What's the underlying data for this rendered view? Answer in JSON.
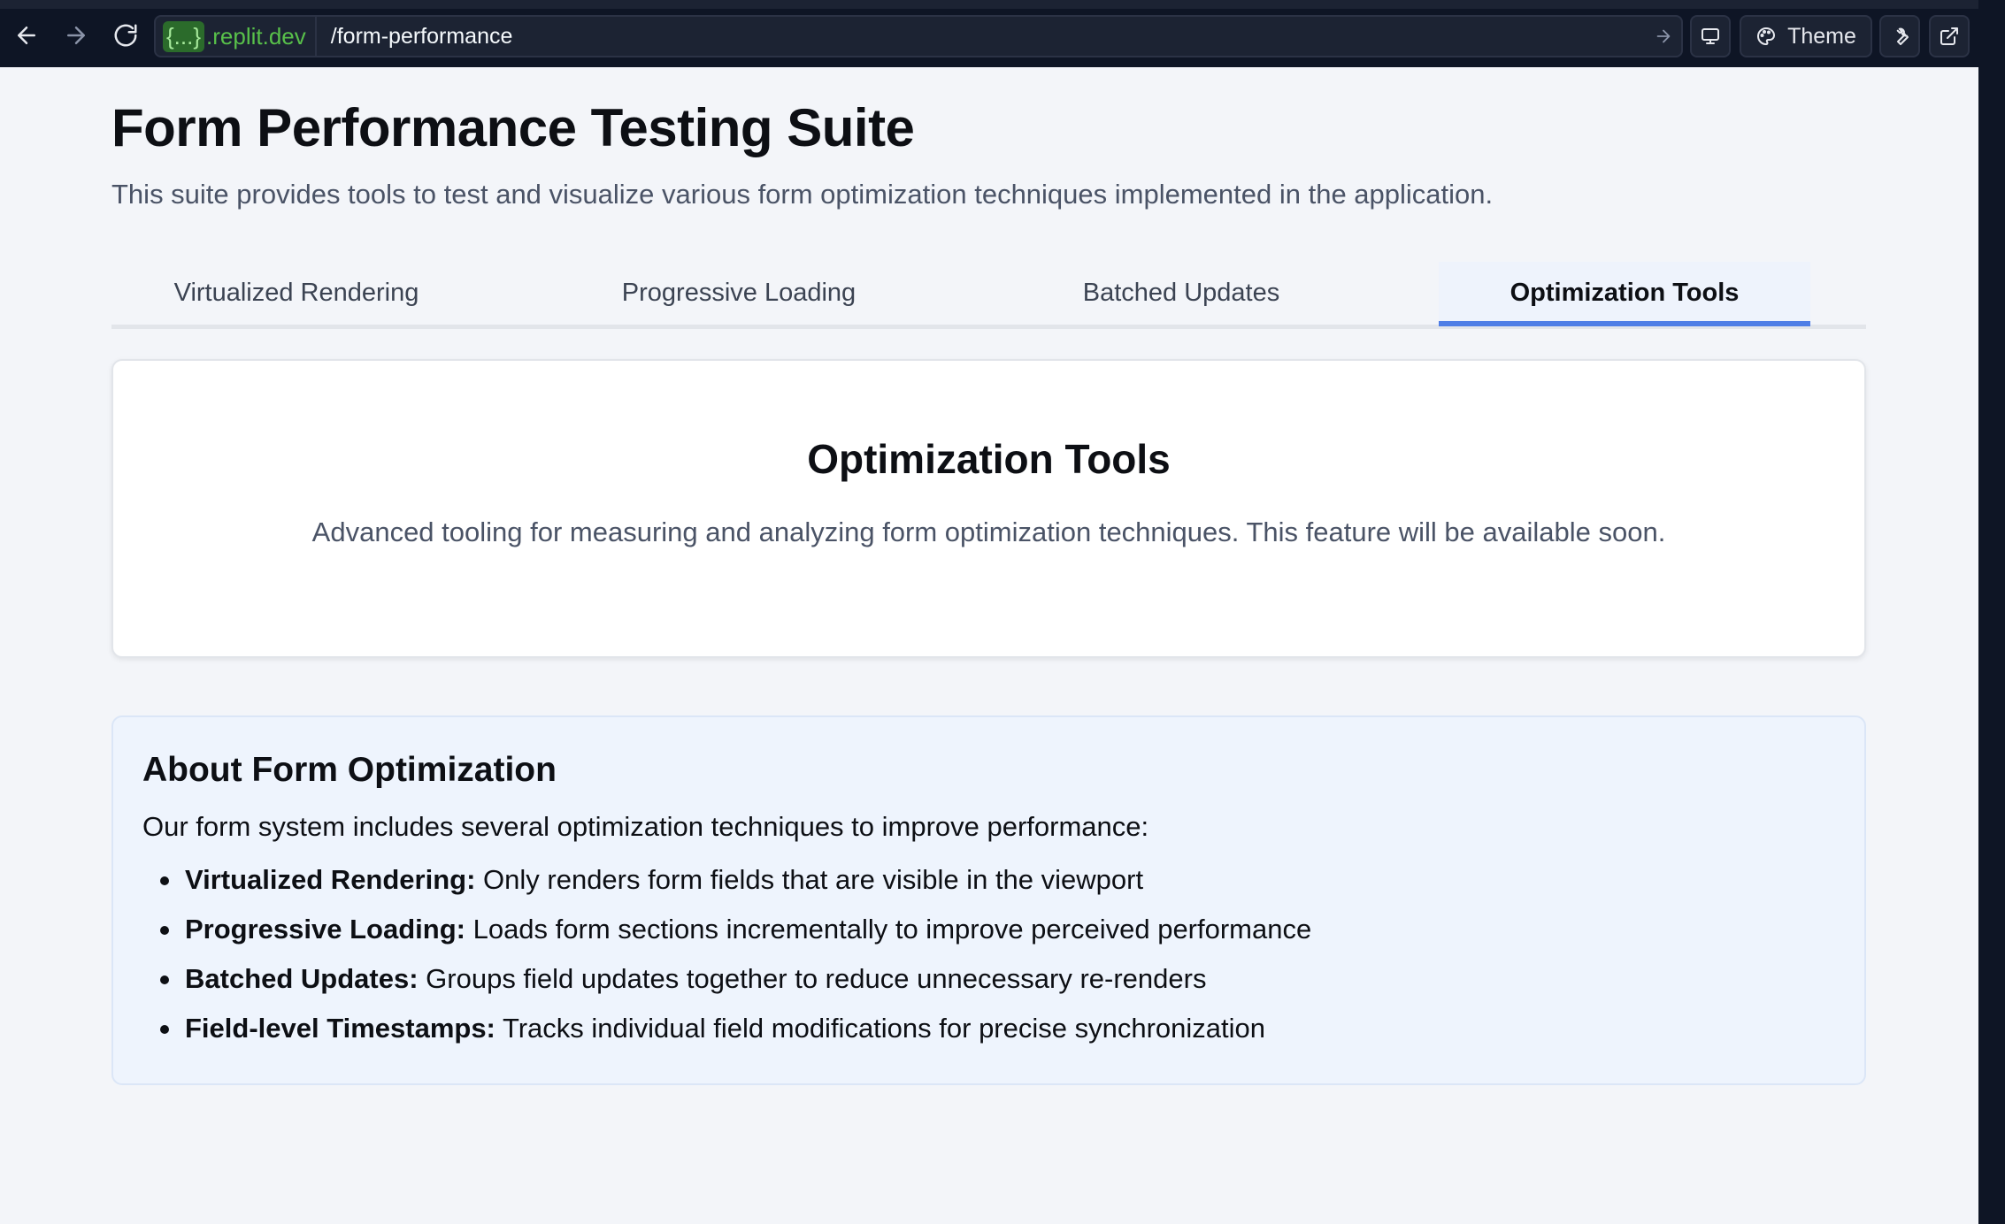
{
  "browser": {
    "url_host_chip": "{...}",
    "url_host": ".replit.dev",
    "url_path": "/form-performance",
    "theme_label": "Theme"
  },
  "page": {
    "title": "Form Performance Testing Suite",
    "subtitle": "This suite provides tools to test and visualize various form optimization techniques implemented in the application."
  },
  "tabs": [
    {
      "label": "Virtualized Rendering",
      "active": false
    },
    {
      "label": "Progressive Loading",
      "active": false
    },
    {
      "label": "Batched Updates",
      "active": false
    },
    {
      "label": "Optimization Tools",
      "active": true
    }
  ],
  "card": {
    "heading": "Optimization Tools",
    "text": "Advanced tooling for measuring and analyzing form optimization techniques. This feature will be available soon."
  },
  "about": {
    "heading": "About Form Optimization",
    "intro": "Our form system includes several optimization techniques to improve performance:",
    "items": [
      {
        "term": "Virtualized Rendering:",
        "desc": " Only renders form fields that are visible in the viewport"
      },
      {
        "term": "Progressive Loading:",
        "desc": " Loads form sections incrementally to improve perceived performance"
      },
      {
        "term": "Batched Updates:",
        "desc": " Groups field updates together to reduce unnecessary re-renders"
      },
      {
        "term": "Field-level Timestamps:",
        "desc": " Tracks individual field modifications for precise synchronization"
      }
    ]
  },
  "colors": {
    "accent": "#4f7ee6",
    "browser_bg": "#0e1525",
    "page_bg": "#f3f5f9"
  }
}
